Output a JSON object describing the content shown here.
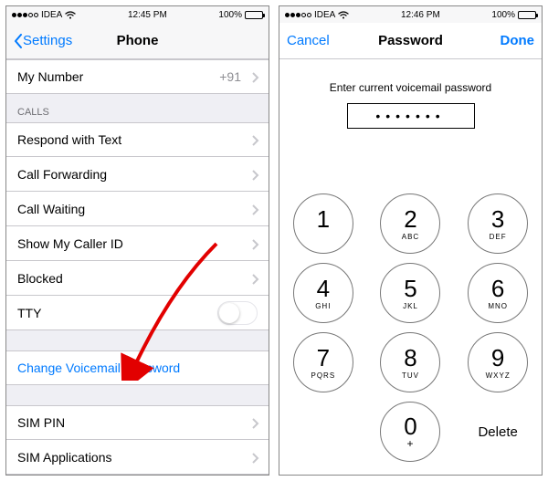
{
  "left": {
    "status": {
      "carrier": "IDEA",
      "time": "12:45 PM",
      "battery": "100%"
    },
    "nav": {
      "back": "Settings",
      "title": "Phone"
    },
    "my_number": {
      "label": "My Number",
      "value": "+91"
    },
    "section_calls": "CALLS",
    "respond": "Respond with Text",
    "forwarding": "Call Forwarding",
    "waiting": "Call Waiting",
    "callerid": "Show My Caller ID",
    "blocked": "Blocked",
    "tty": "TTY",
    "change_pw": "Change Voicemail Password",
    "sim_pin": "SIM PIN",
    "sim_apps": "SIM Applications"
  },
  "right": {
    "status": {
      "carrier": "IDEA",
      "time": "12:46 PM",
      "battery": "100%"
    },
    "nav": {
      "cancel": "Cancel",
      "title": "Password",
      "done": "Done"
    },
    "prompt": "Enter current voicemail password",
    "dots": "•••••••",
    "keypad": [
      {
        "d": "1",
        "l": ""
      },
      {
        "d": "2",
        "l": "ABC"
      },
      {
        "d": "3",
        "l": "DEF"
      },
      {
        "d": "4",
        "l": "GHI"
      },
      {
        "d": "5",
        "l": "JKL"
      },
      {
        "d": "6",
        "l": "MNO"
      },
      {
        "d": "7",
        "l": "PQRS"
      },
      {
        "d": "8",
        "l": "TUV"
      },
      {
        "d": "9",
        "l": "WXYZ"
      }
    ],
    "zero": {
      "d": "0",
      "l": "+"
    },
    "delete": "Delete"
  }
}
